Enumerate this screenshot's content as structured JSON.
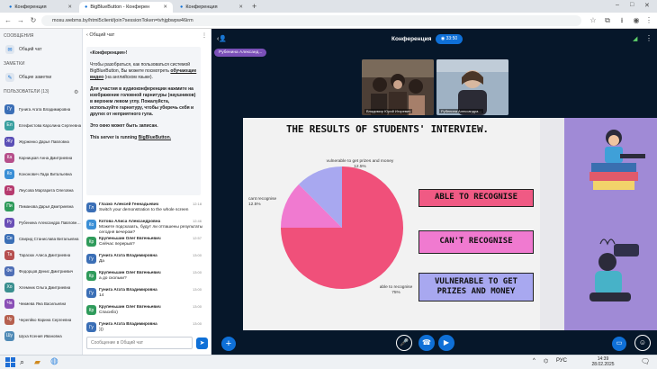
{
  "browser": {
    "tabs": [
      {
        "label": "Конференция"
      },
      {
        "label": "BigBlueButton - Конферен"
      },
      {
        "label": "Конференция"
      }
    ],
    "url": "mosu.webms.by/html5client/join?sessionToken=tvhjgbwpw46irm"
  },
  "sidebar": {
    "messages_title": "СООБЩЕНИЯ",
    "public_chat": "Общий чат",
    "notes_title": "ЗАМЕТКИ",
    "shared_notes": "Общие заметки",
    "users_title": "ПОЛЬЗОВАТЕЛИ (13)",
    "users": [
      {
        "initials": "Гу",
        "name": "Гунига Агата Владимировна",
        "color": "#3b6fb6"
      },
      {
        "initials": "Ел",
        "name": "Елефистова Каролина Сергеевна",
        "color": "#3aa0a0"
      },
      {
        "initials": "Жу",
        "name": "Журженко Дарья Павловна",
        "color": "#5b4fb6"
      },
      {
        "initials": "Ка",
        "name": "Карницкая Анна Дмитриевна",
        "color": "#b64f8a"
      },
      {
        "initials": "Ко",
        "name": "Кононович Лада Витальевна",
        "color": "#3b8fd6"
      },
      {
        "initials": "Ле",
        "name": "Леусова Маргарита Олеговна",
        "color": "#b63b6f"
      },
      {
        "initials": "Пи",
        "name": "Пиманова Дарья Дмитриевна",
        "color": "#2f9b5b"
      },
      {
        "initials": "Ру",
        "name": "Рубенина Александра Павловна (Мой номер)",
        "color": "#6a4fb6"
      },
      {
        "initials": "Св",
        "name": "Свирид Станислава Витальевна",
        "color": "#3b6fb6"
      },
      {
        "initials": "Та",
        "name": "Тарасюк Алиса Дмитриевна",
        "color": "#b64f4f"
      },
      {
        "initials": "Фе",
        "name": "Федорцов Денис Дмитриевич",
        "color": "#4f6fb6"
      },
      {
        "initials": "Хо",
        "name": "Хлемник Ольга Дмитриевна",
        "color": "#3a8f8f"
      },
      {
        "initials": "Ча",
        "name": "Чекмева Яна Васильевна",
        "color": "#8a4fb6"
      },
      {
        "initials": "Чу",
        "name": "Черепйко Карина Сергеевна",
        "color": "#b6604f"
      },
      {
        "initials": "Шу",
        "name": "Шуха Ксения Ивановна",
        "color": "#4f8ab6"
      }
    ]
  },
  "chat": {
    "header": "Общий чат",
    "welcome": {
      "title": "«Конференция»!",
      "p1": "Чтобы разобраться, как пользоваться системой BigBlueButton, Вы можете посмотреть",
      "p1_link": "обучающие видео",
      "p1_tail": "(на английском языке).",
      "p2": "Для участия в аудиоконференции нажмите на изображение головной гарнитуры (наушников) в верхнем левом углу.",
      "p2_bold": "Пожалуйста, используйте гарнитуру, чтобы уберечь себя и других от неприятного гула.",
      "p3": "Это окно может быть записан.",
      "p4": "This server is running",
      "p4_link": "BigBlueButton."
    },
    "messages": [
      {
        "initials": "Гл",
        "color": "#3b6fb6",
        "name": "Глазко Алексей Геннадьевич",
        "time": "12:18",
        "text": "Switch your demonstration to the whole screen"
      },
      {
        "initials": "Ко",
        "color": "#3b8fd6",
        "name": "Котова Алиса Александровна",
        "time": "12:46",
        "text": "Можете подсказать, будут ли отпашены результаты сегодня вечером?"
      },
      {
        "initials": "Кр",
        "color": "#2f9b5b",
        "name": "Крупеньшин Олег Евгеньевич",
        "time": "12:57",
        "text": "Сейчас перерыв?"
      },
      {
        "initials": "Гу",
        "color": "#3b6fb6",
        "name": "Гунига Агата Владимировна",
        "time": "13:00",
        "text": "Да"
      },
      {
        "initials": "Кр",
        "color": "#2f9b5b",
        "name": "Крупеньшин Олег Евгеньевич",
        "time": "13:00",
        "text": "а до скольки?"
      },
      {
        "initials": "Гу",
        "color": "#3b6fb6",
        "name": "Гунига Агата Владимировна",
        "time": "13:00",
        "text": "14"
      },
      {
        "initials": "Кр",
        "color": "#2f9b5b",
        "name": "Крупеньшин Олег Евгеньевич",
        "time": "13:00",
        "text": "Спасибо)"
      },
      {
        "initials": "Гу",
        "color": "#3b6fb6",
        "name": "Гунига Агата Владимировна",
        "time": "13:00",
        "text": ")))"
      }
    ],
    "input_placeholder": "Сообщение в Общий чат"
  },
  "main": {
    "conference_title": "Конференция",
    "recording_time": "33:50",
    "presenter": "Рубенина Александ...",
    "videos": [
      {
        "name": "Владимир Юрий Игоревич"
      },
      {
        "name": "Рубенина Александра..."
      }
    ]
  },
  "slide": {
    "title": "THE RESULTS OF STUDENTS' INTERVIEW.",
    "badges": [
      "ABLE TO RECOGNISE",
      "CAN'T RECOGNISE",
      "VULNERABLE TO GET PRIZES AND MONEY"
    ]
  },
  "chart_data": {
    "type": "pie",
    "categories": [
      "able to recognise",
      "cant recognise",
      "vulnerable to get prizes and money"
    ],
    "values": [
      75,
      12.5,
      12.5
    ],
    "labels": [
      "able to recognise\n75%",
      "cant recognise\n12.5%",
      "vulnerable to get prizes and money\n12.5%"
    ],
    "colors": [
      "#f0507a",
      "#f07ad0",
      "#a8a8f0"
    ]
  },
  "taskbar": {
    "time": "14:39",
    "date": "28.02.2025",
    "lang": "РУС"
  }
}
